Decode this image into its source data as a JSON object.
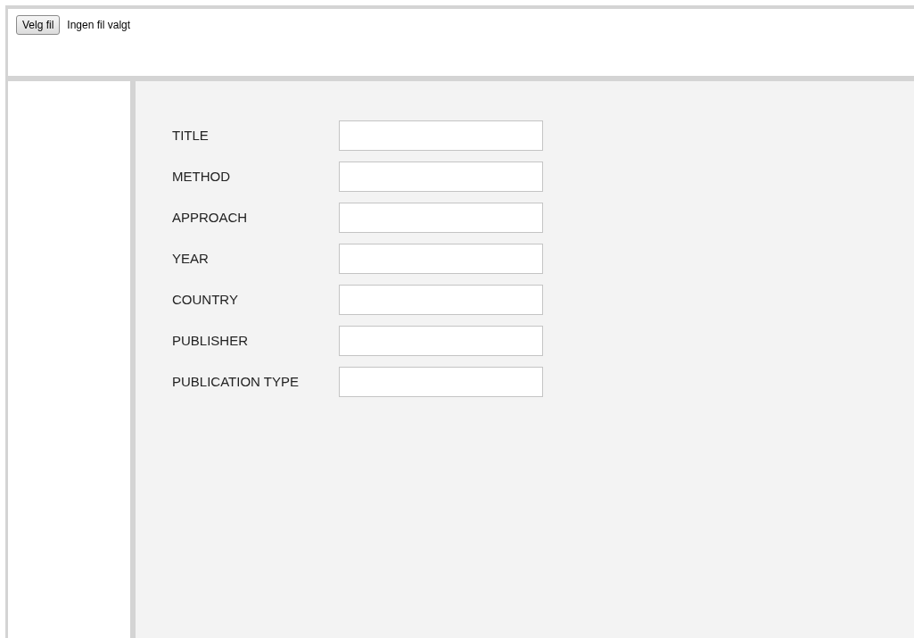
{
  "file_picker": {
    "button": "Velg fil",
    "status": "Ingen fil valgt"
  },
  "form": {
    "fields": [
      {
        "label": "TITLE"
      },
      {
        "label": "METHOD"
      },
      {
        "label": "APPROACH"
      },
      {
        "label": "YEAR"
      },
      {
        "label": "COUNTRY"
      },
      {
        "label": "PUBLISHER"
      },
      {
        "label": "PUBLICATION TYPE"
      }
    ]
  }
}
